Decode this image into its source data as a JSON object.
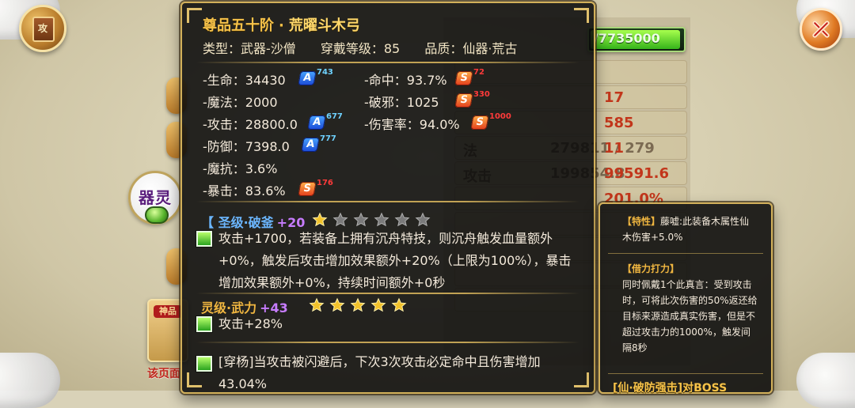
{
  "ui": {
    "hp_text": "/7735000",
    "hp_fraction": 0.97,
    "left_icon_label": "攻",
    "spirit_label": "器灵",
    "side_item_tag": "神品",
    "notice": "该页面"
  },
  "background_stats": {
    "rows": [
      {
        "k": "",
        "v": "",
        "v2": ""
      },
      {
        "k": "",
        "v": "",
        "v2": "17"
      },
      {
        "k": "",
        "v": "",
        "v2": "585"
      },
      {
        "k": "法",
        "v": "279811 / 279",
        "v2": "11"
      },
      {
        "k": "攻击",
        "v": "199854.8",
        "v2": "99591.6"
      },
      {
        "k": "",
        "v": "",
        "v2": "201.0%"
      },
      {
        "k": "",
        "v": "",
        "v2": ""
      },
      {
        "k": "",
        "v": "",
        "v2": ""
      },
      {
        "k": "",
        "v": "",
        "v2": ""
      },
      {
        "k": "",
        "v": "",
        "v2": ""
      }
    ]
  },
  "tooltip": {
    "title_prefix": "尊品五十阶",
    "title_dot": "·",
    "title_name": "荒曜斗木弓",
    "meta": {
      "type": "类型：武器-沙僧",
      "level": "穿戴等级：85",
      "quality": "品质：仙器·荒古"
    },
    "stats_left": [
      {
        "label": "-生命：34430",
        "badge": "A",
        "num": "743"
      },
      {
        "label": "-魔法：2000",
        "badge": "",
        "num": ""
      },
      {
        "label": "-攻击：28800.0",
        "badge": "A",
        "num": "677"
      },
      {
        "label": "-防御：7398.0",
        "badge": "A",
        "num": "777"
      },
      {
        "label": "-魔抗：3.6%",
        "badge": "",
        "num": ""
      },
      {
        "label": "-暴击：83.6%",
        "badge": "S",
        "num": "176"
      }
    ],
    "stats_right": [
      {
        "label": "-命中：93.7%",
        "badge": "S",
        "num": "72"
      },
      {
        "label": "-破邪：1025",
        "badge": "S",
        "num": "330"
      },
      {
        "label": "-伤害率：94.0%",
        "badge": "S",
        "num": "1000"
      }
    ],
    "sections": [
      {
        "title": "【 圣级·破釜",
        "lvl": "+20",
        "stars_filled": 1,
        "stars_total": 6,
        "lines": [
          "攻击+1700，若装备上拥有沉舟特技，则沉舟触发血量额外+0%，触发后攻击增加效果额外+20%（上限为100%），暴击增加效果额外+0%，持续时间额外+0秒"
        ]
      },
      {
        "title": "灵级·武力",
        "lvl": "+43",
        "stars_filled": 5,
        "stars_total": 5,
        "lines": [
          "攻击+28%"
        ]
      },
      {
        "title": "",
        "lvl": "",
        "stars_filled": 0,
        "stars_total": 0,
        "lines": [
          "[穿杨]当攻击被闪避后，下次3次攻击必定命中且伤害增加43.04%"
        ]
      }
    ]
  },
  "side_tooltip": {
    "p1_head": "【特性】",
    "p1_text": "藤嘘:此装备木属性仙木伤害+5.0%",
    "p2_head": "【借力打力】",
    "p2_text": "同时佩戴1个此真言：受到攻击时，可将此次伤害的50%返还给目标来源造成真实伤害，但是不超过攻击力的1000%，触发间隔8秒",
    "footer": "[仙·破防强击]对BOSS"
  },
  "colors": {
    "gold": "#d2b05a",
    "title": "#f6c24a",
    "blue": "#6bb6ff",
    "purple": "#c77cff",
    "green": "#35b31b"
  }
}
